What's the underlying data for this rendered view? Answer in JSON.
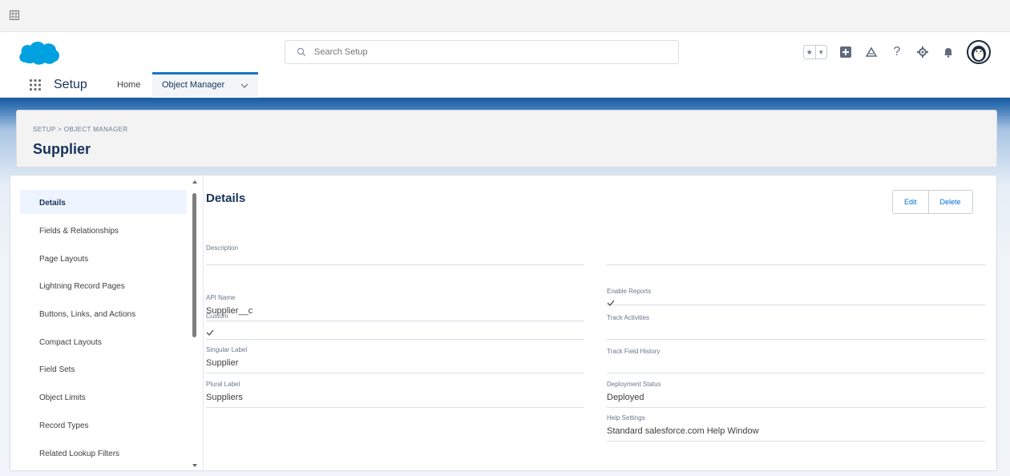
{
  "header": {
    "search_placeholder": "Search Setup"
  },
  "nav": {
    "app_name": "Setup",
    "home": "Home",
    "object_manager": "Object Manager"
  },
  "page": {
    "breadcrumb": "SETUP > OBJECT MANAGER",
    "title": "Supplier"
  },
  "sidebar": {
    "items": [
      {
        "label": "Details"
      },
      {
        "label": "Fields & Relationships"
      },
      {
        "label": "Page Layouts"
      },
      {
        "label": "Lightning Record Pages"
      },
      {
        "label": "Buttons, Links, and Actions"
      },
      {
        "label": "Compact Layouts"
      },
      {
        "label": "Field Sets"
      },
      {
        "label": "Object Limits"
      },
      {
        "label": "Record Types"
      },
      {
        "label": "Related Lookup Filters"
      }
    ]
  },
  "details": {
    "title": "Details",
    "edit": "Edit",
    "delete": "Delete",
    "description_label": "Description",
    "api_name_label": "API Name",
    "api_name_value": "Supplier__c",
    "custom_label": "Custom",
    "singular_label_label": "Singular Label",
    "singular_label_value": "Supplier",
    "plural_label_label": "Plural Label",
    "plural_label_value": "Suppliers",
    "enable_reports_label": "Enable Reports",
    "track_activities_label": "Track Activities",
    "track_field_history_label": "Track Field History",
    "deployment_status_label": "Deployment Status",
    "deployment_status_value": "Deployed",
    "help_settings_label": "Help Settings",
    "help_settings_value": "Standard salesforce.com Help Window"
  }
}
